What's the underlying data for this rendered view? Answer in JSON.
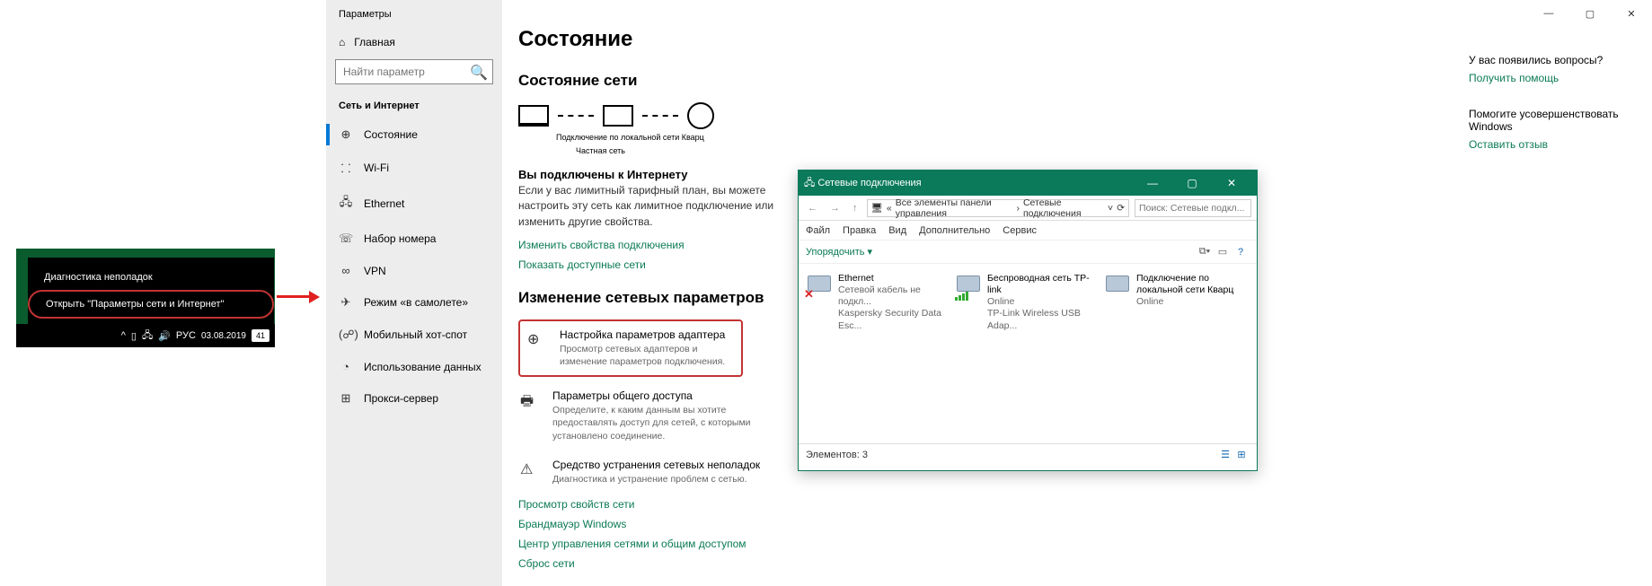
{
  "tray": {
    "item_diag": "Диагностика неполадок",
    "item_open": "Открыть \"Параметры сети и Интернет\"",
    "lang": "РУС",
    "date": "03.08.2019",
    "noti_count": "41"
  },
  "settings": {
    "app_title": "Параметры",
    "home": "Главная",
    "search_placeholder": "Найти параметр",
    "section": "Сеть и Интернет",
    "nav": {
      "status": "Состояние",
      "wifi": "Wi-Fi",
      "ethernet": "Ethernet",
      "dialup": "Набор номера",
      "vpn": "VPN",
      "airplane": "Режим «в самолете»",
      "hotspot": "Мобильный хот-спот",
      "datausage": "Использование данных",
      "proxy": "Прокси-сервер"
    },
    "main": {
      "h1": "Состояние",
      "h2_state": "Состояние сети",
      "conn_name": "Подключение по локальной сети Кварц",
      "net_type": "Частная сеть",
      "connected_h": "Вы подключены к Интернету",
      "connected_p": "Если у вас лимитный тарифный план, вы можете настроить эту сеть как лимитное подключение или изменить другие свойства.",
      "link_props": "Изменить свойства подключения",
      "link_show": "Показать доступные сети",
      "h2_change": "Изменение сетевых параметров",
      "opt_adapter_t": "Настройка параметров адаптера",
      "opt_adapter_d": "Просмотр сетевых адаптеров и изменение параметров подключения.",
      "opt_sharing_t": "Параметры общего доступа",
      "opt_sharing_d": "Определите, к каким данным вы хотите предоставлять доступ для сетей, с которыми установлено соединение.",
      "opt_trouble_t": "Средство устранения сетевых неполадок",
      "opt_trouble_d": "Диагностика и устранение проблем с сетью.",
      "link_netprops": "Просмотр свойств сети",
      "link_firewall": "Брандмауэр Windows",
      "link_center": "Центр управления сетями и общим доступом",
      "link_reset": "Сброс сети"
    },
    "aside": {
      "q1": "У вас появились вопросы?",
      "a1": "Получить помощь",
      "q2": "Помогите усовершенствовать Windows",
      "a2": "Оставить отзыв"
    }
  },
  "nc": {
    "title": "Сетевые подключения",
    "bc1": "Все элементы панели управления",
    "bc2": "Сетевые подключения",
    "search_ph": "Поиск: Сетевые подкл...",
    "menu": {
      "file": "Файл",
      "edit": "Правка",
      "view": "Вид",
      "extra": "Дополнительно",
      "service": "Сервис"
    },
    "organize": "Упорядочить",
    "connections": [
      {
        "name": "Ethernet",
        "status": "Сетевой кабель не подкл...",
        "dev": "Kaspersky Security Data Esc...",
        "kind": "disconnected"
      },
      {
        "name": "Беспроводная сеть TP-link",
        "status": "Online",
        "dev": "TP-Link Wireless USB Adap...",
        "kind": "wifi"
      },
      {
        "name": "Подключение по локальной сети Кварц",
        "status": "Online",
        "dev": "",
        "kind": "lan"
      }
    ],
    "status_text": "Элементов: 3"
  }
}
